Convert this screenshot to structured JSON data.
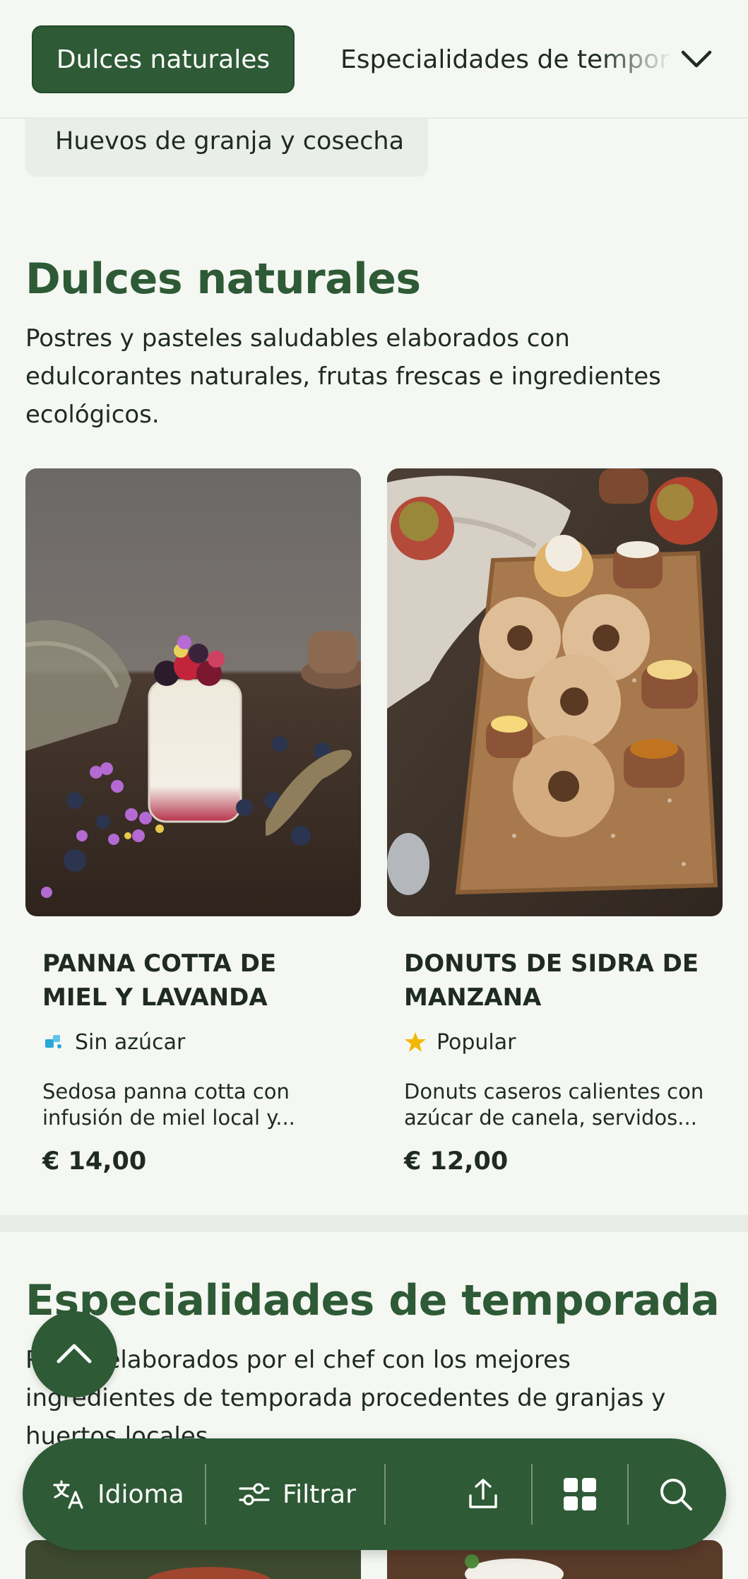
{
  "topbar": {
    "active_category": "Dulces naturales",
    "next_category": "Especialidades de temporada",
    "expand_icon": "chevron-down-icon",
    "second_row_category": "Huevos de granja y cosecha"
  },
  "section1": {
    "title": "Dulces naturales",
    "description": "Postres y pasteles saludables elaborados con edulcorantes naturales, frutas frescas e ingredientes ecológicos."
  },
  "products": [
    {
      "title": "PANNA COTTA DE MIEL Y LAVANDA",
      "badge": "Sin azúcar",
      "badge_icon": "sugar-free-icon",
      "description": "Sedosa panna cotta con infusión de miel local y...",
      "price": "€ 14,00"
    },
    {
      "title": "DONUTS DE SIDRA DE MANZANA",
      "badge": "Popular",
      "badge_icon": "star-icon",
      "description": "Donuts caseros calientes con azúcar de canela, servidos...",
      "price": "€ 12,00"
    }
  ],
  "section2": {
    "title": "Especialidades de temporada",
    "description": "Platos elaborados por el chef con los mejores ingredientes de temporada procedentes de granjas y huertos locales."
  },
  "toolbar": {
    "language_label": "Idioma",
    "filter_label": "Filtrar",
    "share_icon": "share-icon",
    "grid_icon": "grid-view-icon",
    "search_icon": "search-icon"
  },
  "colors": {
    "brand_green": "#2e5a36",
    "background": "#f4f7f2",
    "star": "#f2b705",
    "sugar_free": "#2aa7d8"
  }
}
